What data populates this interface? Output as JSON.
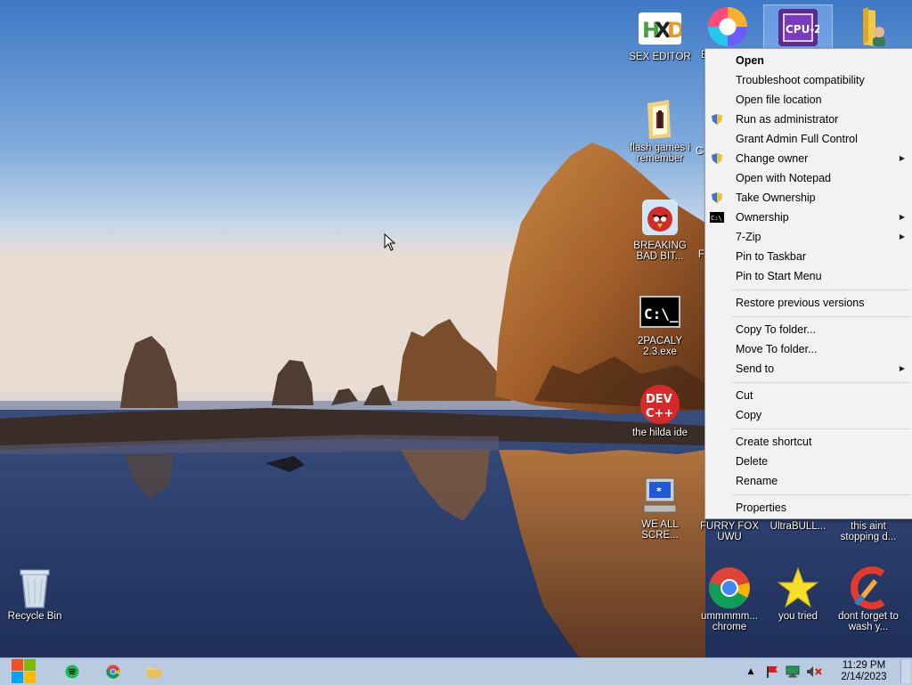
{
  "desktop": {
    "icons": {
      "hex_editor": "SEX EDITOR",
      "browser": "B",
      "flash_games": "flash games i remember",
      "flash_games_extra": "C",
      "breaking_bad": "BREAKING BAD BIT...",
      "breaking_bad_extra": "F",
      "pacaly": "2PACALY 2.3.exe",
      "dev_cpp": "the hilda ide",
      "we_all_scream": "WE ALL SCRE...",
      "furry_fox": "FURRY FOX UWU",
      "ultrabull": "UltraBULL...",
      "this_aint": "this aint stopping d...",
      "recycle_bin": "Recycle Bin",
      "chrome": "ummmmm... chrome",
      "you_tried": "you tried",
      "ccleaner": "dont forget to wash y..."
    }
  },
  "context_menu": {
    "items": [
      "Open",
      "Troubleshoot compatibility",
      "Open file location",
      "Run as administrator",
      "Grant Admin Full Control",
      "Change owner",
      "Open with Notepad",
      "Take Ownership",
      "Ownership",
      "7-Zip",
      "Pin to Taskbar",
      "Pin to Start Menu",
      "Restore previous versions",
      "Copy To folder...",
      "Move To folder...",
      "Send to",
      "Cut",
      "Copy",
      "Create shortcut",
      "Delete",
      "Rename",
      "Properties"
    ]
  },
  "taskbar": {
    "time": "11:29 PM",
    "date": "2/14/2023"
  },
  "colors": {
    "taskbar_bg": "#b9cbe0",
    "menu_bg": "#f2f2f2",
    "accent": "#1e6fd9"
  }
}
